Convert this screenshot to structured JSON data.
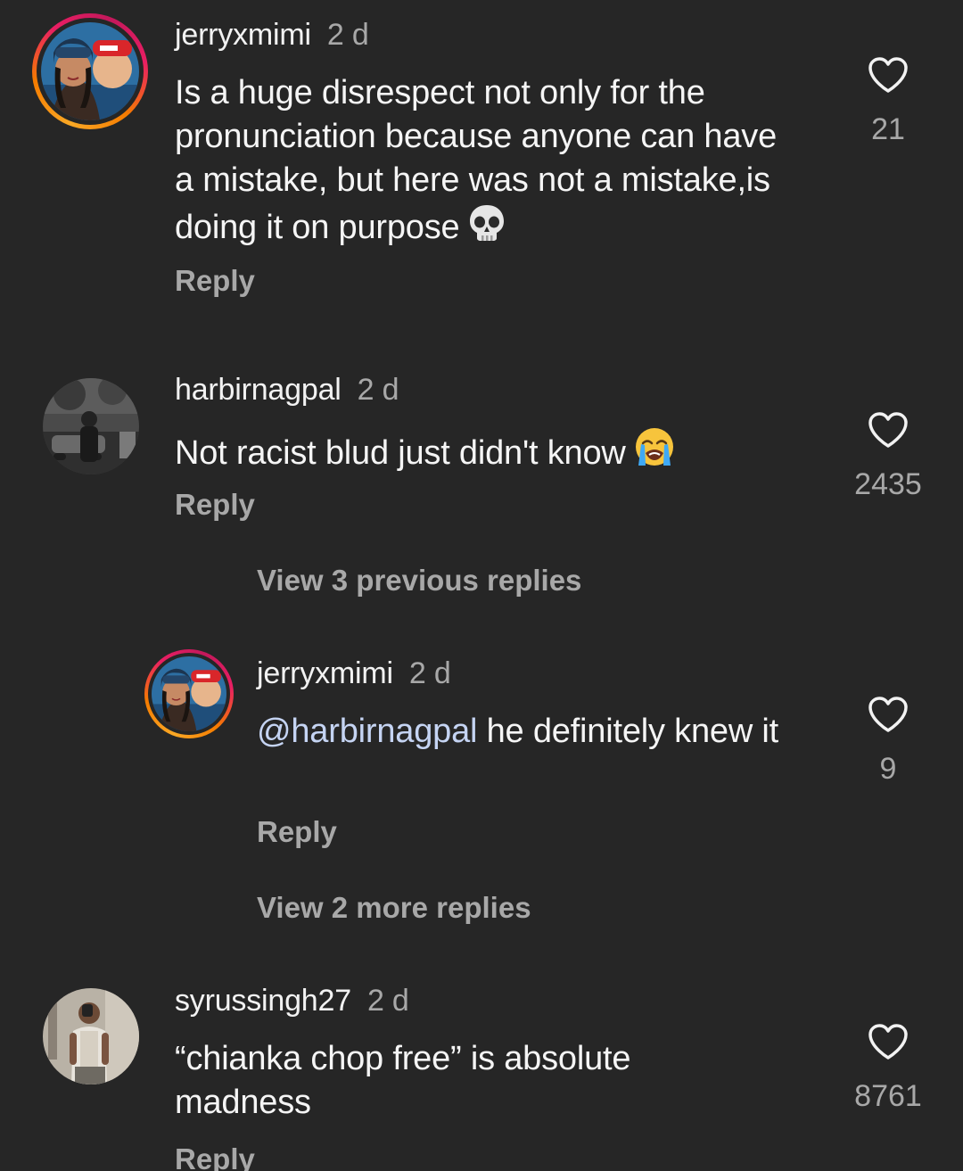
{
  "comments": [
    {
      "username": "jerryxmimi",
      "time": "2 d",
      "text": "Is a huge disrespect not only for the pronunciation because anyone can have a mistake, but here was not a mistake,is doing it on purpose",
      "emoji": "skull-emoji",
      "reply_label": "Reply",
      "likes": "21"
    },
    {
      "username": "harbirnagpal",
      "time": "2 d",
      "text": "Not racist blud just didn't know",
      "emoji": "loudly-crying-emoji",
      "reply_label": "Reply",
      "likes": "2435",
      "view_previous": "View 3 previous replies",
      "replies": [
        {
          "username": "jerryxmimi",
          "time": "2 d",
          "mention": "@harbirnagpal",
          "text": " he definitely knew it",
          "reply_label": "Reply",
          "likes": "9"
        }
      ],
      "view_more": "View 2 more replies"
    },
    {
      "username": "syrussingh27",
      "time": "2 d",
      "text": "“chianka chop free” is absolute madness",
      "reply_label": "Reply",
      "likes": "8761"
    }
  ],
  "colors": {
    "background": "#262626",
    "text": "#f5f5f5",
    "secondary": "#a8a8a8",
    "mention": "#c5d4f3",
    "story_ring": [
      "#f9a825",
      "#e91e63"
    ]
  }
}
